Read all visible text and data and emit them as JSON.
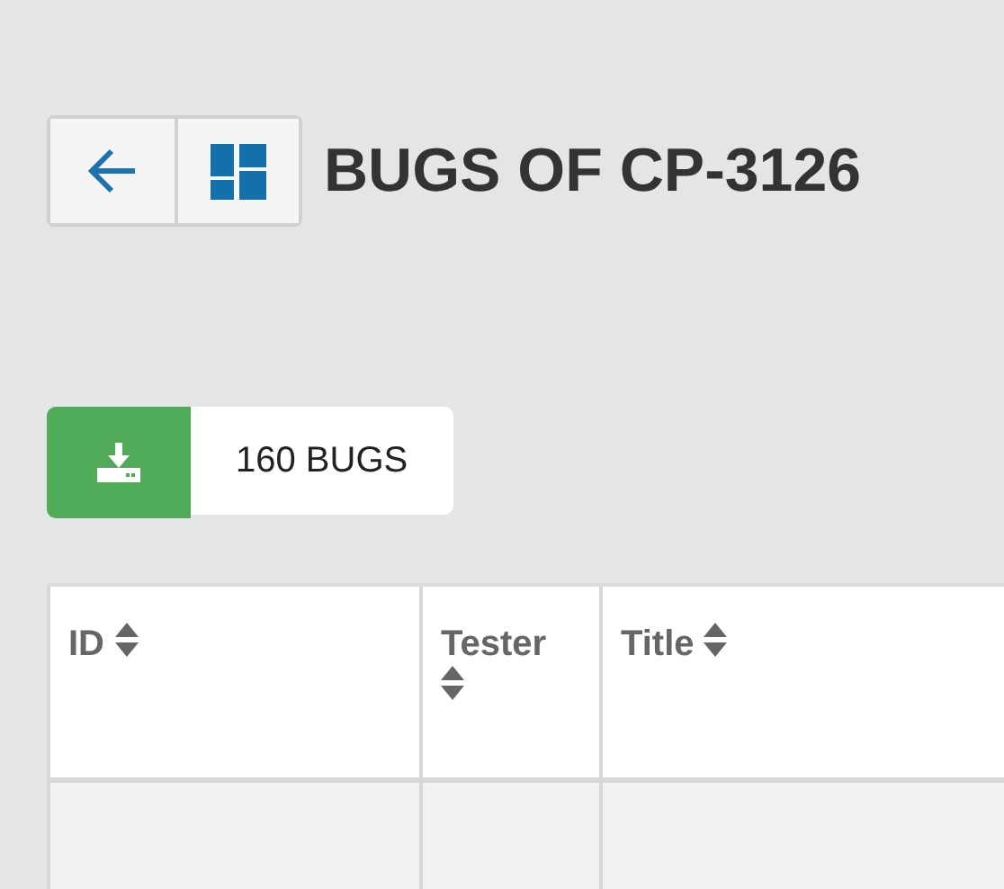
{
  "header": {
    "title": "BUGS OF CP-3126"
  },
  "toolbar": {
    "count": "160 BUGS"
  },
  "table": {
    "columns": [
      {
        "label": "ID"
      },
      {
        "label": "Tester"
      },
      {
        "label": "Title"
      }
    ]
  }
}
